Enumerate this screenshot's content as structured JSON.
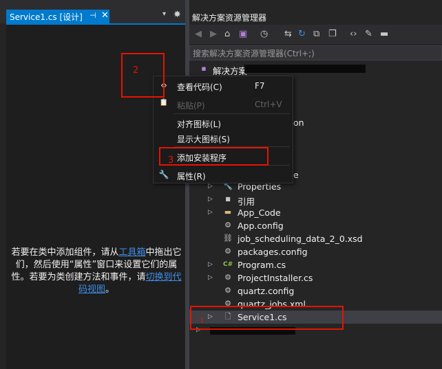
{
  "doc_tab": {
    "title": "Service1.cs [设计]",
    "pin": "⊣",
    "close": "✕"
  },
  "doc_tabbar": {
    "dropdown": "▾",
    "settings": "✸"
  },
  "designer": {
    "msg_1": "若要在类中添加组件，请从",
    "msg_link1": "工具箱",
    "msg_2": "中拖出它们，然后使用“属性”窗口来设置它们的属性。若要为类创建方法和事件，请",
    "msg_link2": "切换到代码视图",
    "msg_3": "。"
  },
  "solution_explorer": {
    "title": "解决方案资源管理器",
    "search_placeholder": "搜索解决方案资源管理器(Ctrl+;)",
    "solution_label": "解决方案",
    "partial_label": "on",
    "partial_label_2": "e",
    "items": [
      {
        "label": "Properties",
        "icon": "wrench-icon",
        "glyph": "🔧"
      },
      {
        "label": "引用",
        "icon": "references-icon",
        "glyph": "■"
      },
      {
        "label": "App_Code",
        "icon": "folder-icon",
        "glyph": "▬"
      },
      {
        "label": "App.config",
        "icon": "config-file-icon",
        "glyph": "⚙"
      },
      {
        "label": "job_scheduling_data_2_0.xsd",
        "icon": "xsd-file-icon",
        "glyph": "⛓"
      },
      {
        "label": "packages.config",
        "icon": "config-file-icon",
        "glyph": "⚙"
      },
      {
        "label": "Program.cs",
        "icon": "csharp-file-icon",
        "glyph": "C#"
      },
      {
        "label": "ProjectInstaller.cs",
        "icon": "component-file-icon",
        "glyph": "⚙"
      },
      {
        "label": "quartz.config",
        "icon": "config-file-icon",
        "glyph": "⚙"
      },
      {
        "label": "quartz_jobs.xml",
        "icon": "xml-file-icon",
        "glyph": "⚙"
      },
      {
        "label": "Service1.cs",
        "icon": "component-file-icon",
        "glyph": "🗋"
      }
    ]
  },
  "context_menu": {
    "view_code": {
      "label": "查看代码(C)",
      "shortcut": "F7",
      "glyph": "‹›"
    },
    "paste": {
      "label": "粘贴(P)",
      "shortcut": "Ctrl+V",
      "glyph": "📋"
    },
    "align_icons": {
      "label": "对齐图标(L)"
    },
    "show_large_icons": {
      "label": "显示大图标(S)"
    },
    "add_installer": {
      "label": "添加安装程序"
    },
    "properties": {
      "label": "属性(R)",
      "glyph": "🔧"
    }
  },
  "annotations": {
    "one": "1",
    "two": "2",
    "three": "3",
    "color": "#e51400"
  },
  "colors": {
    "accent": "#007acc",
    "background": "#252526",
    "menu": "#1b1b1c"
  }
}
